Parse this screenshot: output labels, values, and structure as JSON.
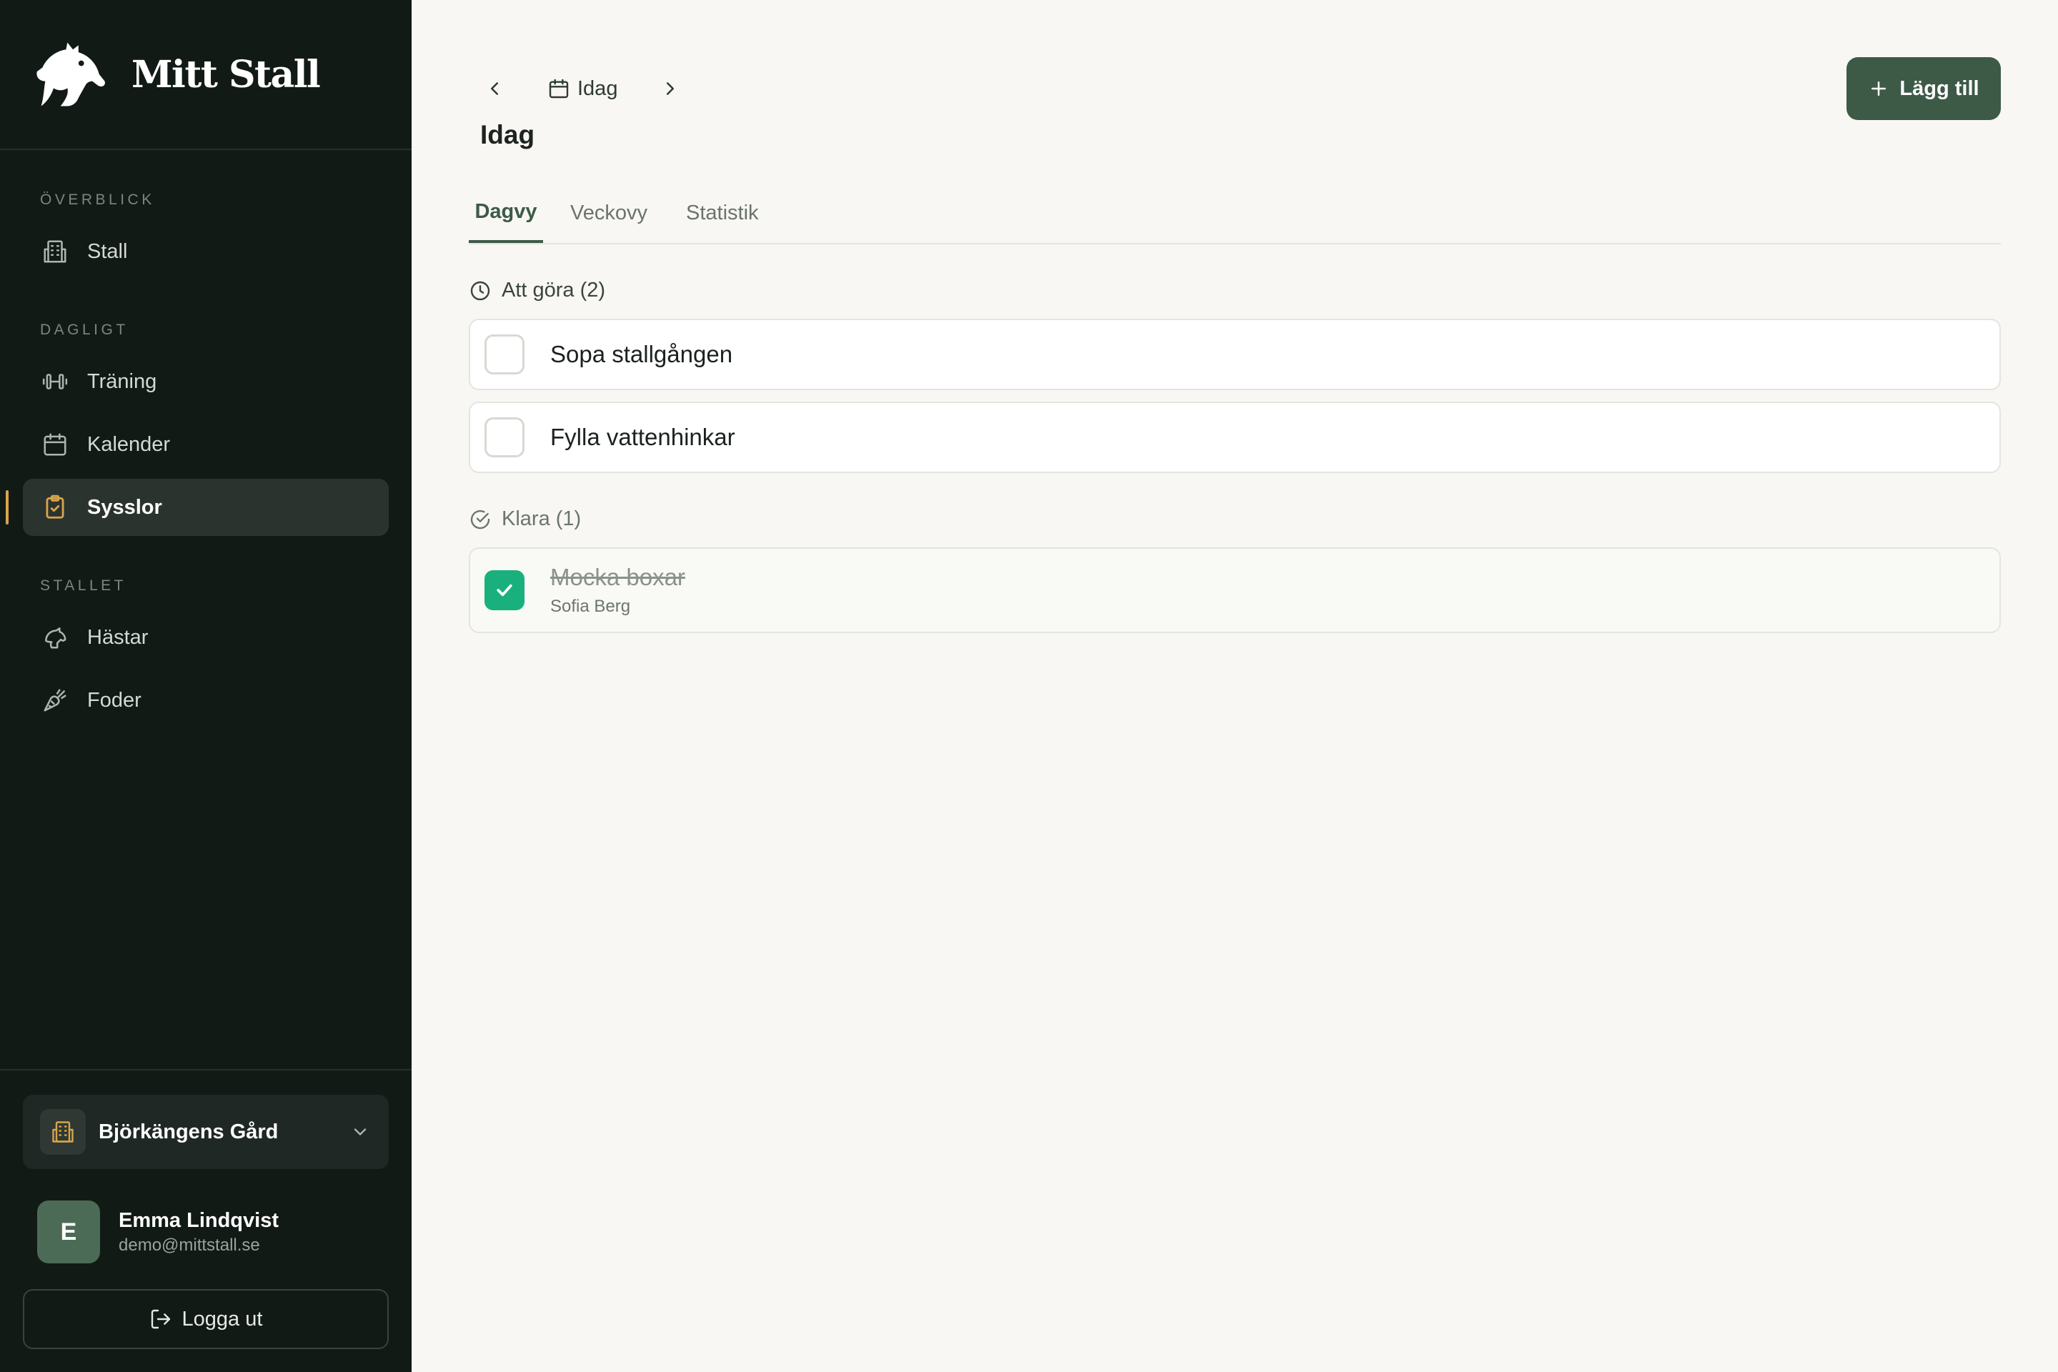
{
  "brand": {
    "name": "Mitt Stall"
  },
  "sidebar": {
    "sections": [
      {
        "label": "ÖVERBLICK",
        "items": [
          {
            "label": "Stall",
            "icon": "building-icon"
          }
        ]
      },
      {
        "label": "DAGLIGT",
        "items": [
          {
            "label": "Träning",
            "icon": "dumbbell-icon"
          },
          {
            "label": "Kalender",
            "icon": "calendar-icon"
          },
          {
            "label": "Sysslor",
            "icon": "clipboard-check-icon",
            "active": true
          }
        ]
      },
      {
        "label": "STALLET",
        "items": [
          {
            "label": "Hästar",
            "icon": "horse-icon"
          },
          {
            "label": "Foder",
            "icon": "carrot-icon"
          }
        ]
      }
    ],
    "farm": {
      "name": "Björkängens Gård"
    },
    "user": {
      "initial": "E",
      "name": "Emma Lindqvist",
      "email": "demo@mittstall.se"
    },
    "logout_label": "Logga ut"
  },
  "main": {
    "date_label": "Idag",
    "title": "Idag",
    "add_label": "Lägg till",
    "tabs": [
      {
        "label": "Dagvy",
        "active": true
      },
      {
        "label": "Veckovy"
      },
      {
        "label": "Statistik"
      }
    ],
    "todo": {
      "heading": "Att göra (2)",
      "tasks": [
        {
          "title": "Sopa stallgången",
          "done": false
        },
        {
          "title": "Fylla vattenhinkar",
          "done": false
        }
      ]
    },
    "done": {
      "heading": "Klara (1)",
      "tasks": [
        {
          "title": "Mocka boxar",
          "assignee": "Sofia Berg",
          "done": true
        }
      ]
    }
  },
  "colors": {
    "sidebar_bg": "#121a16",
    "accent_green": "#3d5a47",
    "check_green": "#19b07d",
    "active_marker": "#d9a44a",
    "page_bg": "#f8f7f3"
  }
}
